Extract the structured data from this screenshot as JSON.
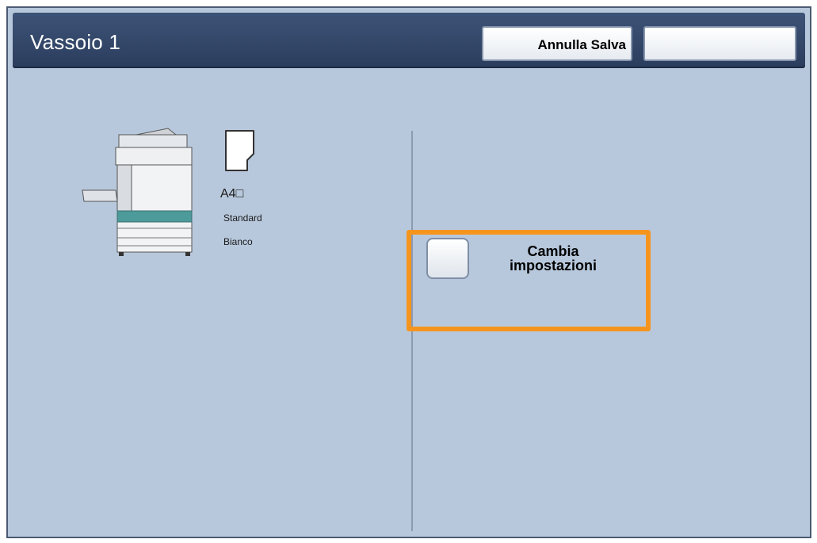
{
  "header": {
    "title": "Vassoio 1",
    "cancel_save_label": "Annulla Salva",
    "empty_button_label": ""
  },
  "tray": {
    "machine_icon": "printer-icon",
    "paper_icon": "paper-orientation-icon",
    "paper_size": "A4□",
    "paper_type": "Standard",
    "paper_color": "Bianco"
  },
  "actions": {
    "change_settings_line1": "Cambia",
    "change_settings_line2": "impostazioni",
    "highlight_color": "#f5951e"
  },
  "colors": {
    "background": "#b8c8dc",
    "title_bar": "#2b3d5d"
  }
}
